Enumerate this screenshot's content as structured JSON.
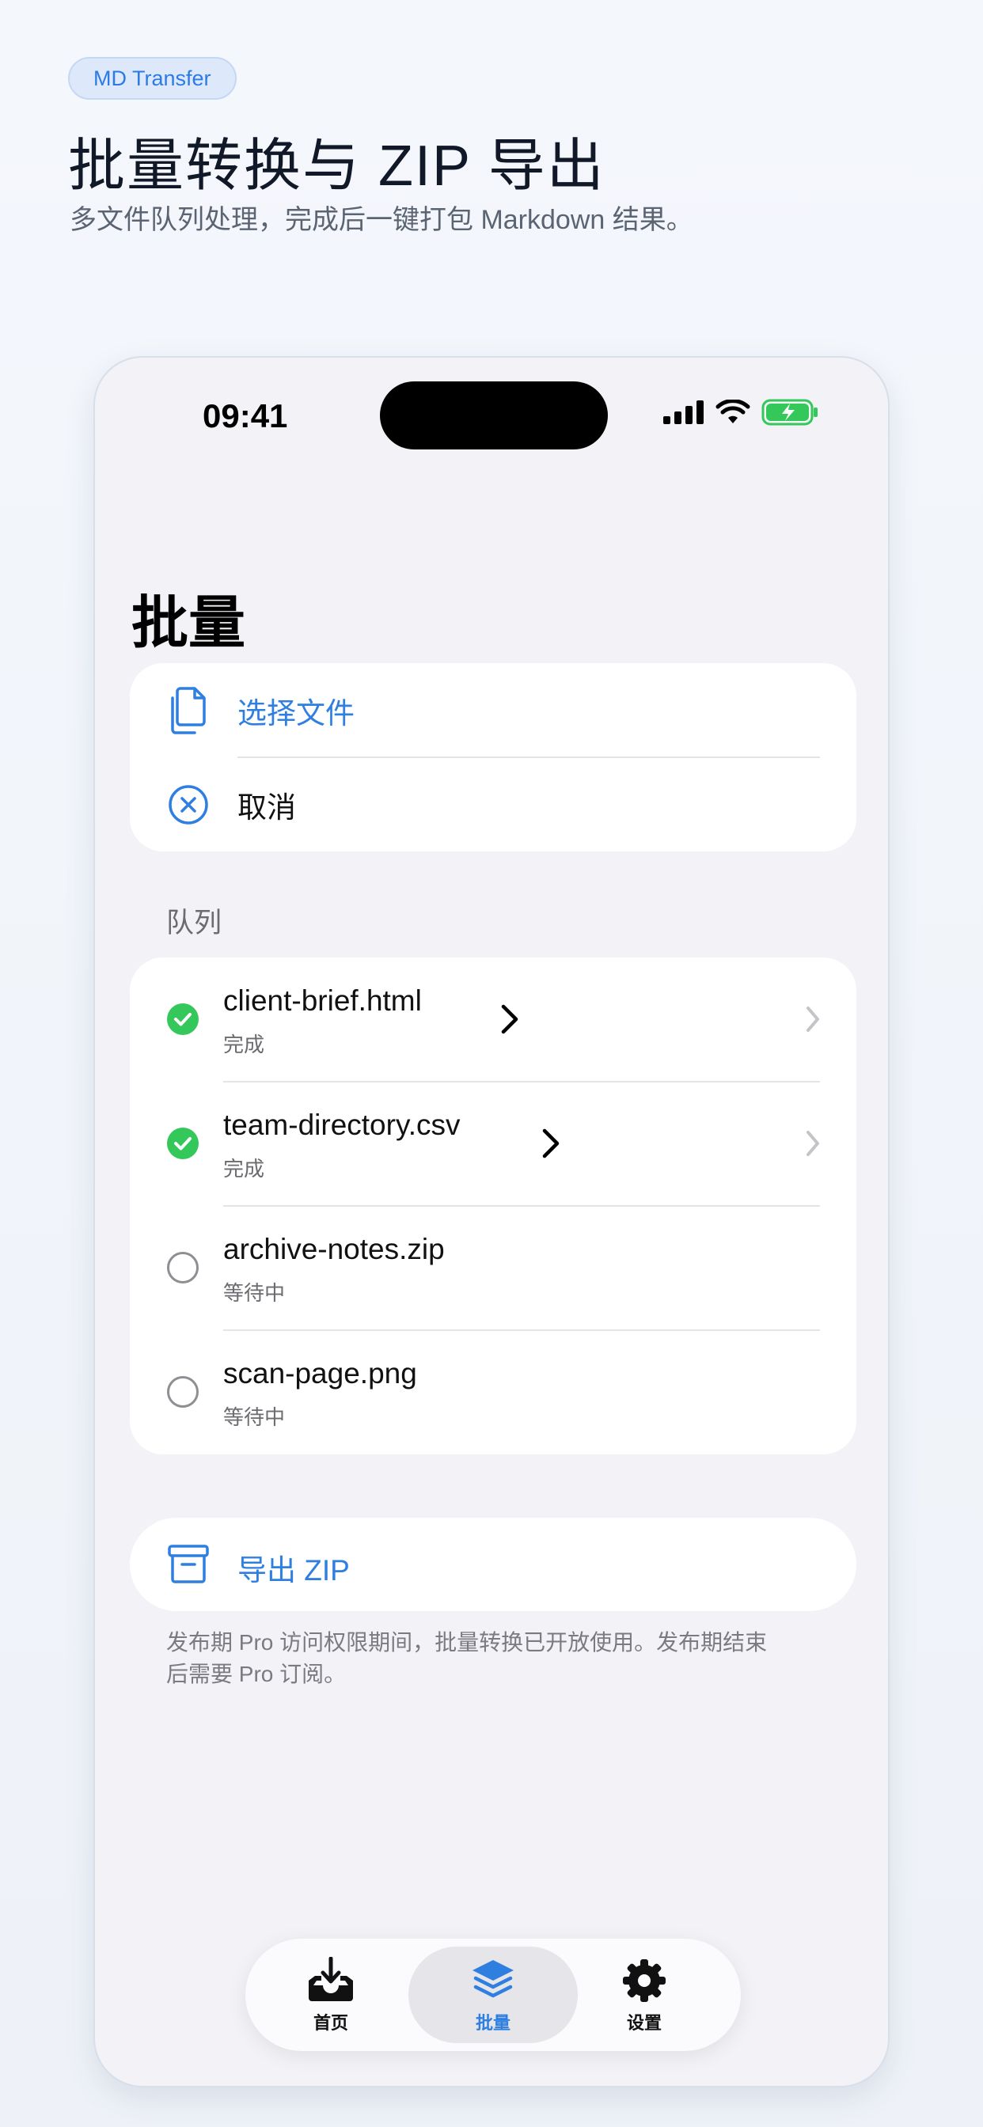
{
  "badge": "MD Transfer",
  "headline": "批量转换与 ZIP 导出",
  "subline": "多文件队列处理，完成后一键打包 Markdown 结果。",
  "status_bar": {
    "time": "09:41",
    "battery": "charging"
  },
  "page_title": "批量",
  "actions": {
    "choose_files": "选择文件",
    "cancel": "取消"
  },
  "queue": {
    "label": "队列",
    "items": [
      {
        "name": "client-brief.html",
        "state": "完成",
        "done": true
      },
      {
        "name": "team-directory.csv",
        "state": "完成",
        "done": true
      },
      {
        "name": "archive-notes.zip",
        "state": "等待中",
        "done": false
      },
      {
        "name": "scan-page.png",
        "state": "等待中",
        "done": false
      }
    ]
  },
  "export": {
    "label": "导出 ZIP"
  },
  "footnote": "发布期 Pro 访问权限期间，批量转换已开放使用。发布期结束后需要 Pro 订阅。",
  "tabs": [
    {
      "label": "首页",
      "icon": "tray-download-icon",
      "active": false
    },
    {
      "label": "批量",
      "icon": "stack-layers-icon",
      "active": true
    },
    {
      "label": "设置",
      "icon": "gear-icon",
      "active": false
    }
  ],
  "colors": {
    "accent": "#2f7fe0",
    "success": "#34c759",
    "background": "#f2f2f7"
  }
}
